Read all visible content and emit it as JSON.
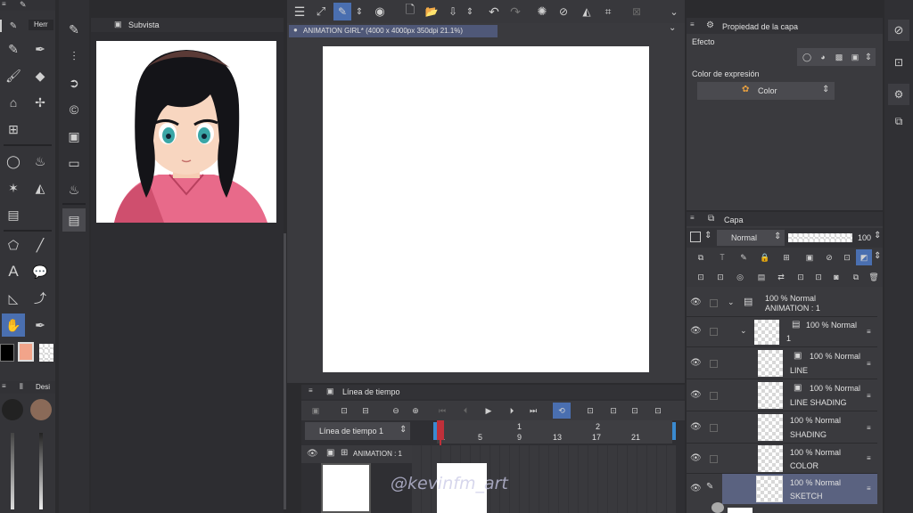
{
  "tools_panel": {
    "tab_label": "Herr",
    "subtools_label": "Desi"
  },
  "subview": {
    "title": "Subvista"
  },
  "canvas_tab": {
    "title": "ANIMATION GIRL* (4000 x 4000px 350dpi 21.1%)"
  },
  "layer_property": {
    "title": "Propiedad de la capa",
    "effect_label": "Efecto",
    "expression_color_label": "Color de expresión",
    "expression_color_value": "Color"
  },
  "layer_panel": {
    "title": "Capa",
    "blend_mode": "Normal",
    "opacity": "100",
    "layers": [
      {
        "line1": "100 % Normal",
        "line2": "ANIMATION : 1"
      },
      {
        "line1": "100 % Normal",
        "line2": "1"
      },
      {
        "line1": "100 % Normal",
        "line2": "LINE"
      },
      {
        "line1": "100 % Normal",
        "line2": "LINE SHADING"
      },
      {
        "line1": "100 % Normal",
        "line2": "SHADING"
      },
      {
        "line1": "100 % Normal",
        "line2": "COLOR"
      },
      {
        "line1": "100 % Normal",
        "line2": "SKETCH"
      }
    ]
  },
  "timeline": {
    "title": "Línea de tiempo",
    "selector": "Línea de tiempo 1",
    "track_label": "ANIMATION : 1",
    "ruler_top": [
      "1",
      "2"
    ],
    "ruler_bottom": [
      "1",
      "5",
      "9",
      "13",
      "17",
      "21"
    ]
  },
  "watermark": "@kevinfm_art",
  "colors": {
    "accent": "#4a6fb0",
    "main": "#000000",
    "sub": "#f2a48a",
    "playhead": "#c0303a"
  }
}
